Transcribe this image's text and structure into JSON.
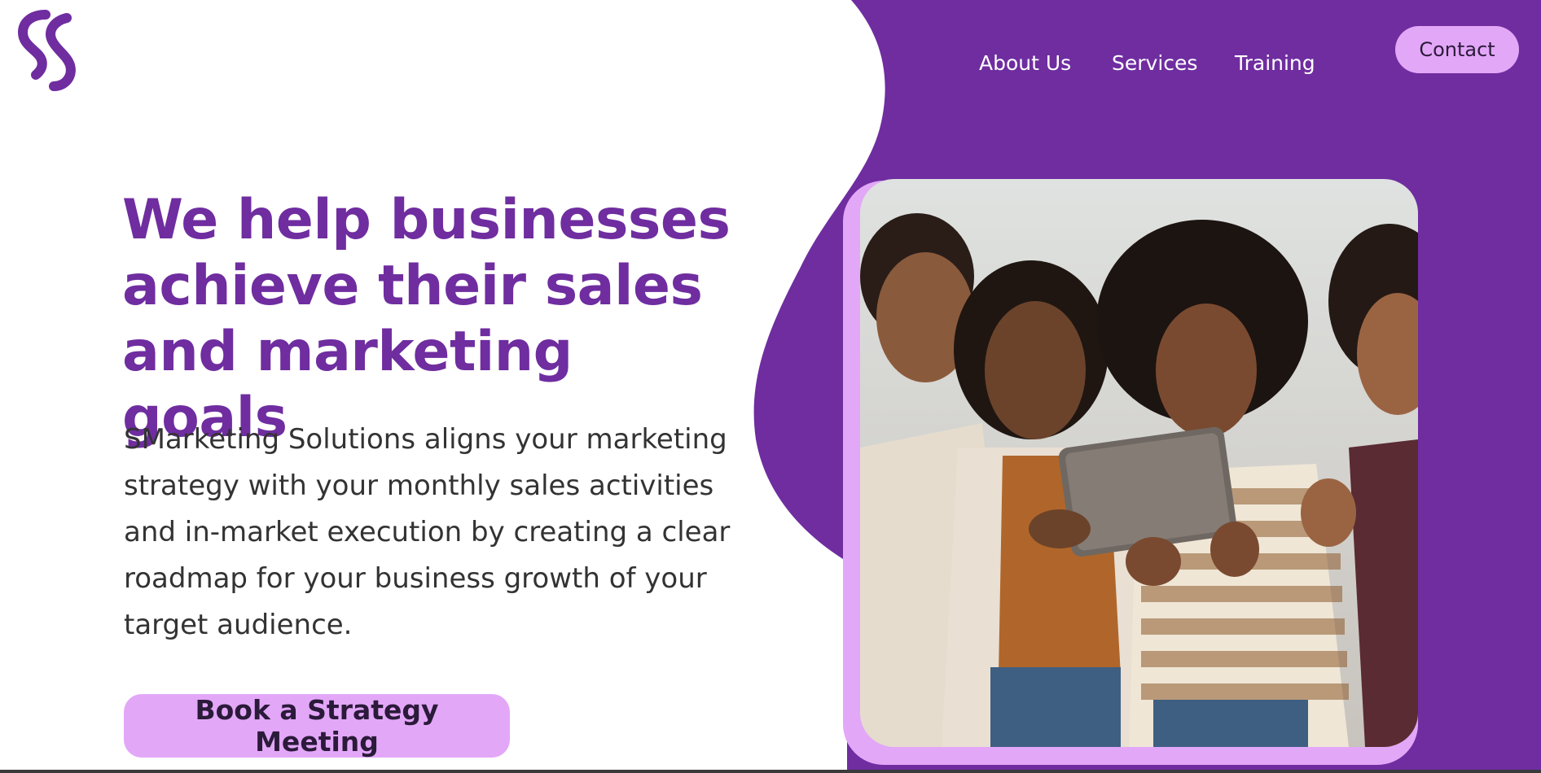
{
  "colors": {
    "brand_purple": "#6F2DA0",
    "accent_lilac": "#E3A7F8",
    "nav_text": "#ffffff",
    "body_text": "#333333"
  },
  "header": {
    "logo_icon": "ss-logo-icon",
    "nav": [
      {
        "label": "About Us"
      },
      {
        "label": "Services"
      },
      {
        "label": "Training"
      }
    ],
    "contact_label": "Contact"
  },
  "hero": {
    "title_lines": [
      "We help businesses",
      "achieve their sales",
      "and marketing goals"
    ],
    "description": "SMarketing Solutions aligns your marketing strategy with your monthly sales activities and in-market execution by creating a clear roadmap for your business growth of your target audience.",
    "cta_label": "Book a Strategy Meeting",
    "image": "group-of-friends-looking-at-tablet-photo"
  }
}
